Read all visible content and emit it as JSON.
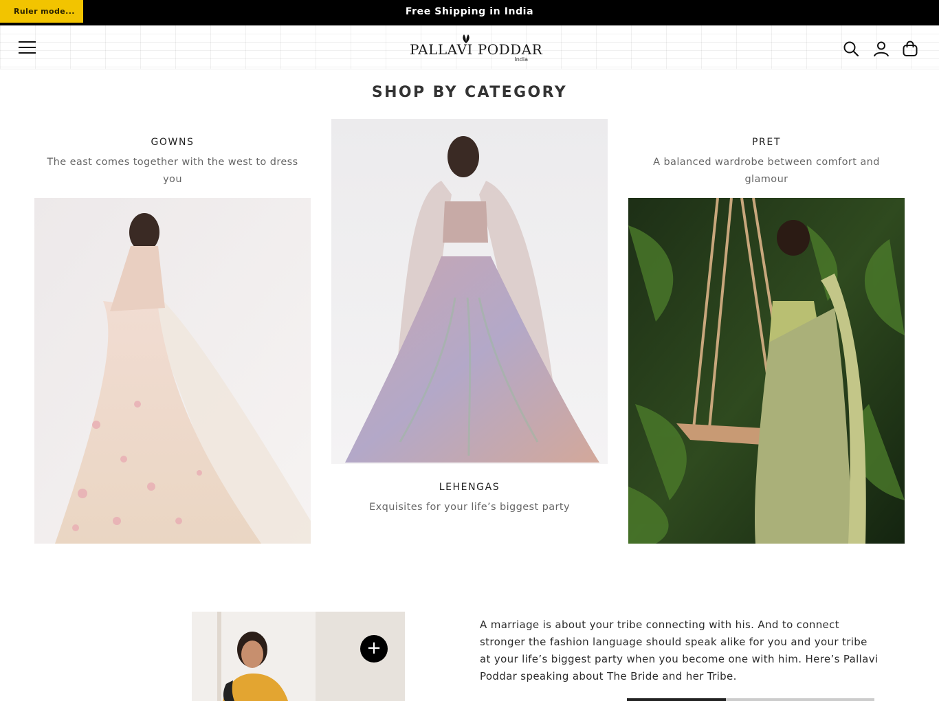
{
  "announcement": {
    "text": "Free Shipping in India",
    "ruler_badge": "Ruler mode..."
  },
  "header": {
    "brand": "PALLAVI PODDAR",
    "brand_sub": "India",
    "icons": [
      "menu-icon",
      "search-icon",
      "account-icon",
      "bag-icon"
    ]
  },
  "section": {
    "title": "SHOP BY CATEGORY"
  },
  "categories": [
    {
      "name": "GOWNS",
      "description": "The east comes together with the west to dress you"
    },
    {
      "name": "LEHENGAS",
      "description": "Exquisites for your life’s biggest party"
    },
    {
      "name": "PRET",
      "description": "A balanced wardrobe between comfort and glamour"
    }
  ],
  "story": {
    "text": "A marriage is about your tribe connecting with his. And to connect stronger the fashion language should speak alike for you and your tribe at your life’s biggest party when you become one with him. Here’s Pallavi Poddar speaking about The Bride and her Tribe.",
    "plus_label": "+"
  },
  "colors": {
    "announcement_bg": "#000000",
    "ruler_badge": "#f2c400",
    "text": "#222222",
    "muted": "#666666"
  }
}
